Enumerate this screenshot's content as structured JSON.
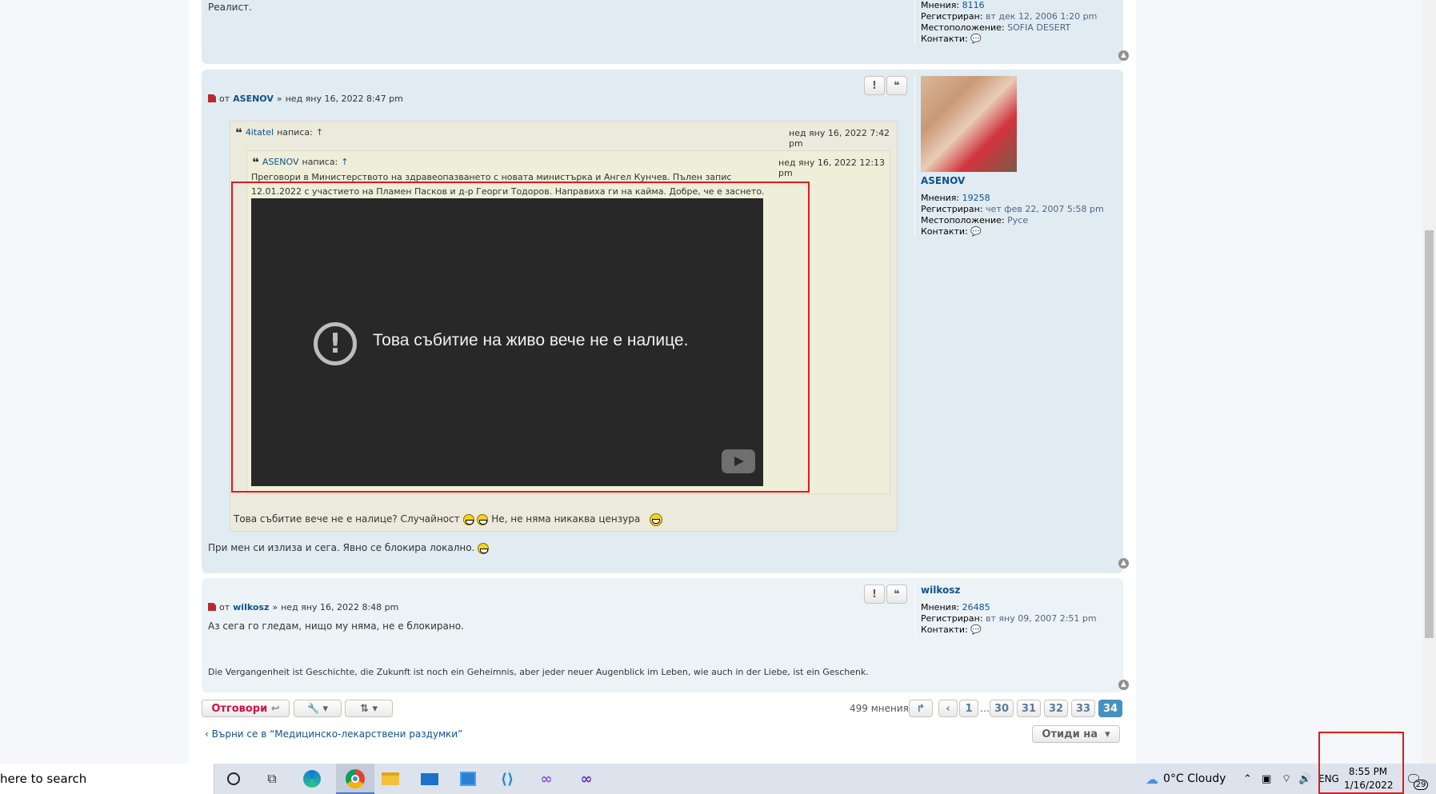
{
  "post_prev": {
    "text_tail": "Реалист.",
    "profile": {
      "posts_label": "Мнения:",
      "posts": "8116",
      "reg_label": "Регистриран:",
      "reg": "вт дек 12, 2006 1:20 pm",
      "loc_label": "Местоположение:",
      "loc": "SOFIA DESERT",
      "contact_label": "Контакти:"
    }
  },
  "post1": {
    "by": "от",
    "author": "ASENOV",
    "sep": "»",
    "date": "нед яну 16, 2022 8:47 pm",
    "report": "!",
    "quote": "❝",
    "quote_outer": {
      "author": "4itatel",
      "wrote": "написа:",
      "arrow": "↑",
      "date": "нед яну 16, 2022 7:42 pm"
    },
    "quote_inner": {
      "author": "ASENOV",
      "wrote": "написа:",
      "arrow": "↑",
      "date": "нед яну 16, 2022 12:13 pm",
      "line1": "Преговори в Министерството на здравеопазването с новата министърка и Ангел Кунчев. Пълен запис",
      "line2": "12.01.2022 с участието на Пламен Пасков и д-р Георги Тодоров. Направиха ги на кайма. Добре, че е заснето."
    },
    "video": {
      "message": "Това събитие на живо вече не е налице."
    },
    "outer_text_a": "Това събитие вече не е налице? Случайност",
    "outer_text_b": "Не, не няма никаква цензура",
    "body": "При мен си излиза и сега. Явно се блокира локално.",
    "profile": {
      "name": "ASENOV",
      "posts_label": "Мнения:",
      "posts": "19258",
      "reg_label": "Регистриран:",
      "reg": "чет фев 22, 2007 5:58 pm",
      "loc_label": "Местоположение:",
      "loc": "Русе",
      "contact_label": "Контакти:"
    }
  },
  "post2": {
    "by": "от",
    "author": "wilkosz",
    "sep": "»",
    "date": "нед яну 16, 2022 8:48 pm",
    "report": "!",
    "quote": "❝",
    "body": "Аз сега го гледам, нищо му няма, не е блокирано.",
    "signature": "Die Vergangenheit ist Geschichte, die Zukunft ist noch ein Geheimnis, aber jeder neuer Augenblick im Leben, wie auch in der Liebe, ist ein Geschenk.",
    "profile": {
      "name": "wilkosz",
      "posts_label": "Мнения:",
      "posts": "26485",
      "reg_label": "Регистриран:",
      "reg": "вт яну 09, 2007 2:51 pm",
      "contact_label": "Контакти:"
    }
  },
  "actions": {
    "reply": "Отговори",
    "reply_icon": "↩",
    "tools_icon": "🔧",
    "sort_icon": "⇅",
    "dropdown": "▾",
    "count": "499 мнения",
    "pages": [
      "1",
      "…",
      "30",
      "31",
      "32",
      "33",
      "34"
    ],
    "active_page": "34",
    "back_link": "‹ Върни се в “Медицинско-лекарствени раздумки”",
    "jump": "Отиди на"
  },
  "taskbar": {
    "search": "here to search",
    "weather": "0°C  Cloudy",
    "lang": "ENG",
    "time": "8:55 PM",
    "date": "1/16/2022",
    "notif": "29"
  }
}
